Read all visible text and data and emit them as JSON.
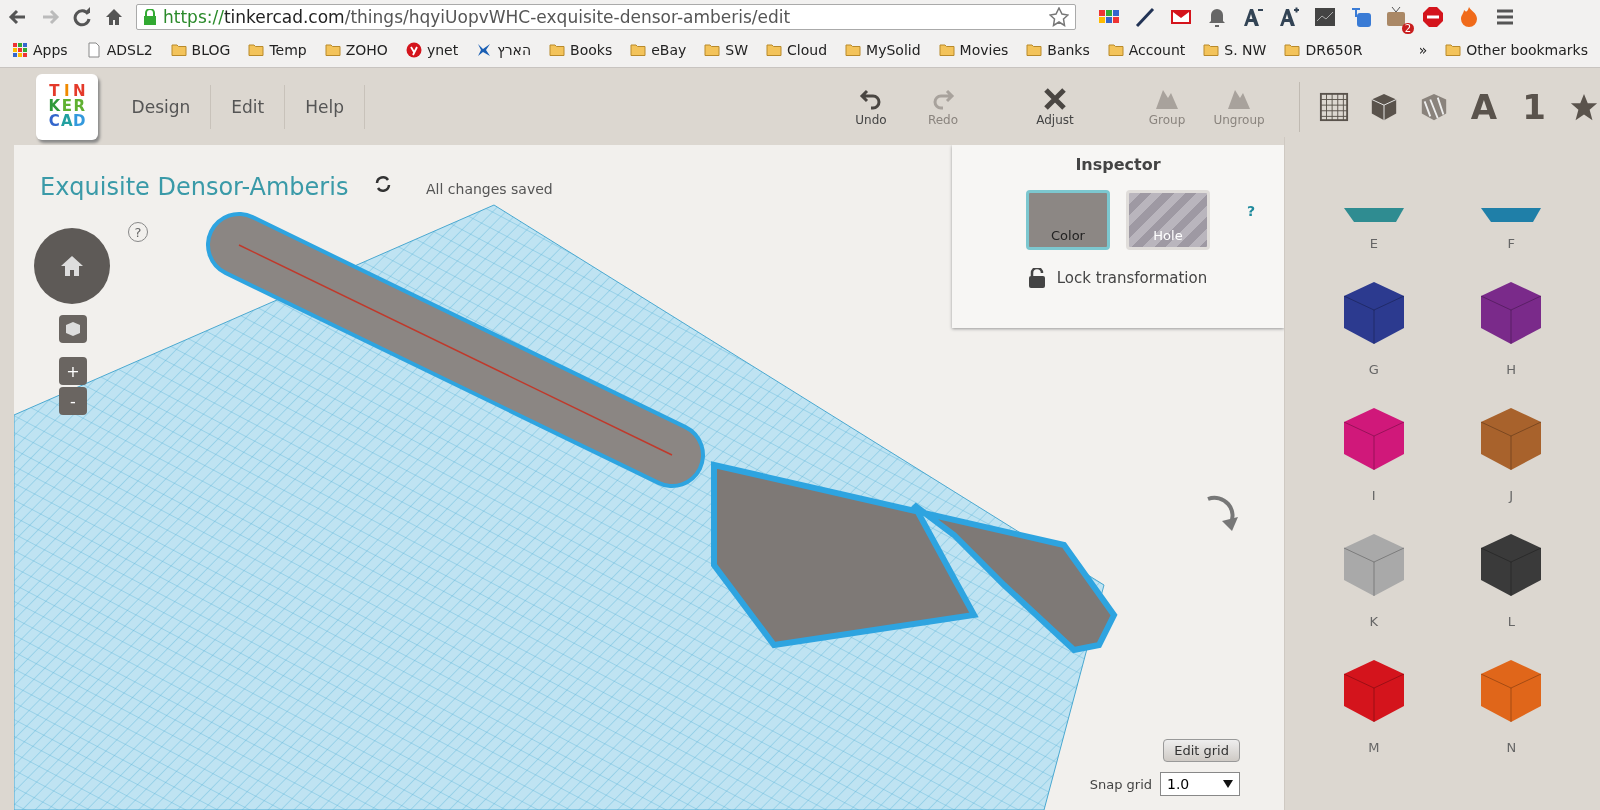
{
  "browser": {
    "url_secure_part": "https://",
    "url_host": "tinkercad.com",
    "url_path": "/things/hqyiUopvWHC-exquisite-densor-amberis/edit",
    "extension_badge": "2",
    "bookmarks": [
      {
        "label": "Apps",
        "kind": "apps"
      },
      {
        "label": "ADSL2",
        "kind": "page"
      },
      {
        "label": "BLOG",
        "kind": "folder"
      },
      {
        "label": "Temp",
        "kind": "folder"
      },
      {
        "label": "ZOHO",
        "kind": "folder"
      },
      {
        "label": "ynet",
        "kind": "site"
      },
      {
        "label": "הארץ",
        "kind": "flag"
      },
      {
        "label": "Books",
        "kind": "folder"
      },
      {
        "label": "eBay",
        "kind": "folder"
      },
      {
        "label": "SW",
        "kind": "folder"
      },
      {
        "label": "Cloud",
        "kind": "folder"
      },
      {
        "label": "MySolid",
        "kind": "folder"
      },
      {
        "label": "Movies",
        "kind": "folder"
      },
      {
        "label": "Banks",
        "kind": "folder"
      },
      {
        "label": "Account",
        "kind": "folder"
      },
      {
        "label": "S. NW",
        "kind": "folder"
      },
      {
        "label": "DR650R",
        "kind": "folder"
      }
    ],
    "overflow": "»",
    "other_bookmarks": "Other bookmarks"
  },
  "logo": [
    {
      "letter": "T",
      "color": "#e43a2a"
    },
    {
      "letter": "I",
      "color": "#f08a00"
    },
    {
      "letter": "N",
      "color": "#e43a2a"
    },
    {
      "letter": "K",
      "color": "#2f9a3a"
    },
    {
      "letter": "E",
      "color": "#5fb030"
    },
    {
      "letter": "R",
      "color": "#5fb030"
    },
    {
      "letter": "C",
      "color": "#3366cc"
    },
    {
      "letter": "A",
      "color": "#22a0a0"
    },
    {
      "letter": "D",
      "color": "#3399dd"
    }
  ],
  "menu": [
    {
      "label": "Design"
    },
    {
      "label": "Edit"
    },
    {
      "label": "Help"
    }
  ],
  "toolbar": [
    {
      "label": "Undo",
      "kind": "undo",
      "disabled": false
    },
    {
      "label": "Redo",
      "kind": "redo",
      "disabled": true
    },
    {
      "label": "Adjust",
      "kind": "adjust",
      "disabled": false
    },
    {
      "label": "Group",
      "kind": "group",
      "disabled": true
    },
    {
      "label": "Ungroup",
      "kind": "group",
      "disabled": true
    }
  ],
  "categories": [
    {
      "kind": "grid"
    },
    {
      "kind": "cube"
    },
    {
      "kind": "striped"
    },
    {
      "kind": "text",
      "label": "A"
    },
    {
      "kind": "text",
      "label": "1"
    },
    {
      "kind": "star"
    }
  ],
  "design": {
    "title": "Exquisite Densor-Amberis",
    "save_status": "All changes saved",
    "help": "?",
    "zoom_in": "+",
    "zoom_out": "-"
  },
  "inspector": {
    "title": "Inspector",
    "help": "?",
    "options": [
      {
        "label": "Color",
        "kind": "solid",
        "selected": true
      },
      {
        "label": "Hole",
        "kind": "hole",
        "selected": false
      }
    ],
    "lock": "Lock transformation"
  },
  "grid": {
    "edit_button": "Edit grid",
    "snap_label": "Snap grid",
    "snap_value": "1.0"
  },
  "shapes": [
    {
      "label": "E",
      "color": "#2f8c91"
    },
    {
      "label": "F",
      "color": "#1f7fa8"
    },
    {
      "label": "G",
      "color": "#2c3a8f"
    },
    {
      "label": "H",
      "color": "#7a2a8a"
    },
    {
      "label": "I",
      "color": "#d0187a"
    },
    {
      "label": "J",
      "color": "#a8622c"
    },
    {
      "label": "K",
      "color": "#a9a9a9"
    },
    {
      "label": "L",
      "color": "#3a3a3a"
    },
    {
      "label": "M",
      "color": "#d4141c"
    },
    {
      "label": "N",
      "color": "#e0661a"
    }
  ]
}
